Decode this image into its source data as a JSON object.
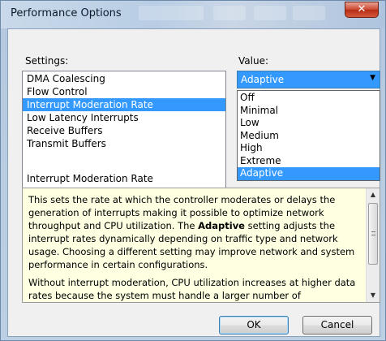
{
  "window": {
    "title": "Performance Options",
    "close_glyph": "✕"
  },
  "settings": {
    "label": "Settings:",
    "items": [
      "DMA Coalescing",
      "Flow Control",
      "Interrupt Moderation Rate",
      "Low Latency Interrupts",
      "Receive Buffers",
      "Transmit Buffers"
    ],
    "selected_index": 2
  },
  "value": {
    "label": "Value:",
    "current": "Adaptive",
    "options": [
      "Off",
      "Minimal",
      "Low",
      "Medium",
      "High",
      "Extreme",
      "Adaptive"
    ],
    "selected_index": 6
  },
  "description": {
    "title": "Interrupt Moderation Rate",
    "p1_before": "This sets the rate at which the controller moderates or delays the generation of interrupts making it possible to optimize network throughput and CPU utilization. The ",
    "p1_bold": "Adaptive",
    "p1_after": " setting adjusts the interrupt rates dynamically depending on traffic type and network usage. Choosing a different setting may improve network and system performance in certain configurations.",
    "p2": "Without interrupt moderation, CPU utilization increases at higher data rates because the system must handle a larger number of"
  },
  "buttons": {
    "ok": "OK",
    "cancel": "Cancel"
  },
  "colors": {
    "selection": "#3399ff",
    "description_bg": "#ffffe1",
    "close_button": "#c9452d"
  }
}
